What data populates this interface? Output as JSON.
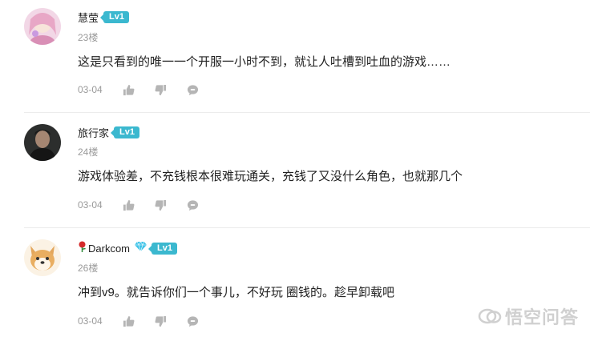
{
  "comments": [
    {
      "username": "慧莹",
      "level": "Lv1",
      "floor": "23楼",
      "text": "这是只看到的唯一一个开服一小时不到，就让人吐槽到吐血的游戏……",
      "date": "03-04"
    },
    {
      "username": "旅行家",
      "level": "Lv1",
      "floor": "24楼",
      "text": "游戏体验差，不充钱根本很难玩通关，充钱了又没什么角色，也就那几个",
      "date": "03-04"
    },
    {
      "username": "Darkcom",
      "level": "Lv1",
      "floor": "26楼",
      "text": "冲到v9。就告诉你们一个事儿，不好玩 圈钱的。趁早卸载吧",
      "date": "03-04"
    }
  ],
  "watermark": "悟空问答",
  "icons": [
    "like-icon",
    "dislike-icon",
    "reply-icon",
    "rose-icon",
    "diamond-icon",
    "wukong-logo-icon"
  ],
  "colors": {
    "level_badge": "#3bb8cf",
    "meta_gray": "#9a9a9a",
    "icon_gray": "#b5b5b5",
    "text": "#222222"
  }
}
